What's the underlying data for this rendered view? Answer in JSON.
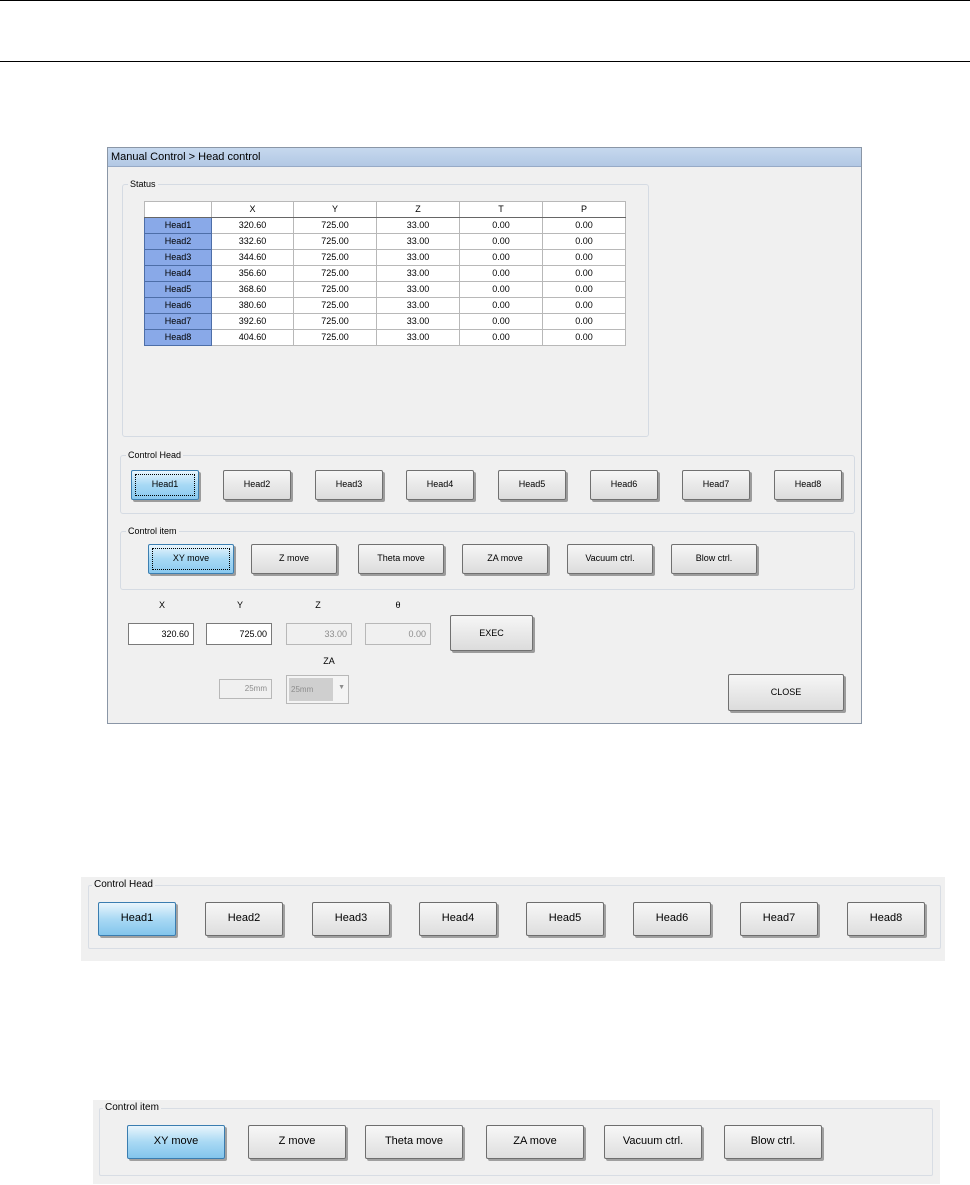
{
  "window": {
    "title": "Manual Control > Head control"
  },
  "status": {
    "label": "Status",
    "columns": [
      "",
      "X",
      "Y",
      "Z",
      "T",
      "P"
    ],
    "rows": [
      [
        "Head1",
        "320.60",
        "725.00",
        "33.00",
        "0.00",
        "0.00"
      ],
      [
        "Head2",
        "332.60",
        "725.00",
        "33.00",
        "0.00",
        "0.00"
      ],
      [
        "Head3",
        "344.60",
        "725.00",
        "33.00",
        "0.00",
        "0.00"
      ],
      [
        "Head4",
        "356.60",
        "725.00",
        "33.00",
        "0.00",
        "0.00"
      ],
      [
        "Head5",
        "368.60",
        "725.00",
        "33.00",
        "0.00",
        "0.00"
      ],
      [
        "Head6",
        "380.60",
        "725.00",
        "33.00",
        "0.00",
        "0.00"
      ],
      [
        "Head7",
        "392.60",
        "725.00",
        "33.00",
        "0.00",
        "0.00"
      ],
      [
        "Head8",
        "404.60",
        "725.00",
        "33.00",
        "0.00",
        "0.00"
      ]
    ]
  },
  "control_head": {
    "label": "Control Head",
    "buttons": [
      "Head1",
      "Head2",
      "Head3",
      "Head4",
      "Head5",
      "Head6",
      "Head7",
      "Head8"
    ],
    "selected": "Head1"
  },
  "control_item": {
    "label": "Control item",
    "buttons": [
      "XY move",
      "Z move",
      "Theta move",
      "ZA move",
      "Vacuum ctrl.",
      "Blow ctrl."
    ],
    "selected": "XY move"
  },
  "move": {
    "x_label": "X",
    "x_value": "320.60",
    "y_label": "Y",
    "y_value": "725.00",
    "z_label": "Z",
    "z_value": "33.00",
    "theta_label": "θ",
    "theta_value": "0.00",
    "exec_label": "EXEC",
    "za_label": "ZA",
    "za_value": "25mm",
    "za_select": "25mm",
    "close_label": "CLOSE"
  },
  "colors": {
    "selected_button": "#a7d9f5",
    "row_header": "#89a9e8",
    "titlebar": "#c6d8ee"
  }
}
